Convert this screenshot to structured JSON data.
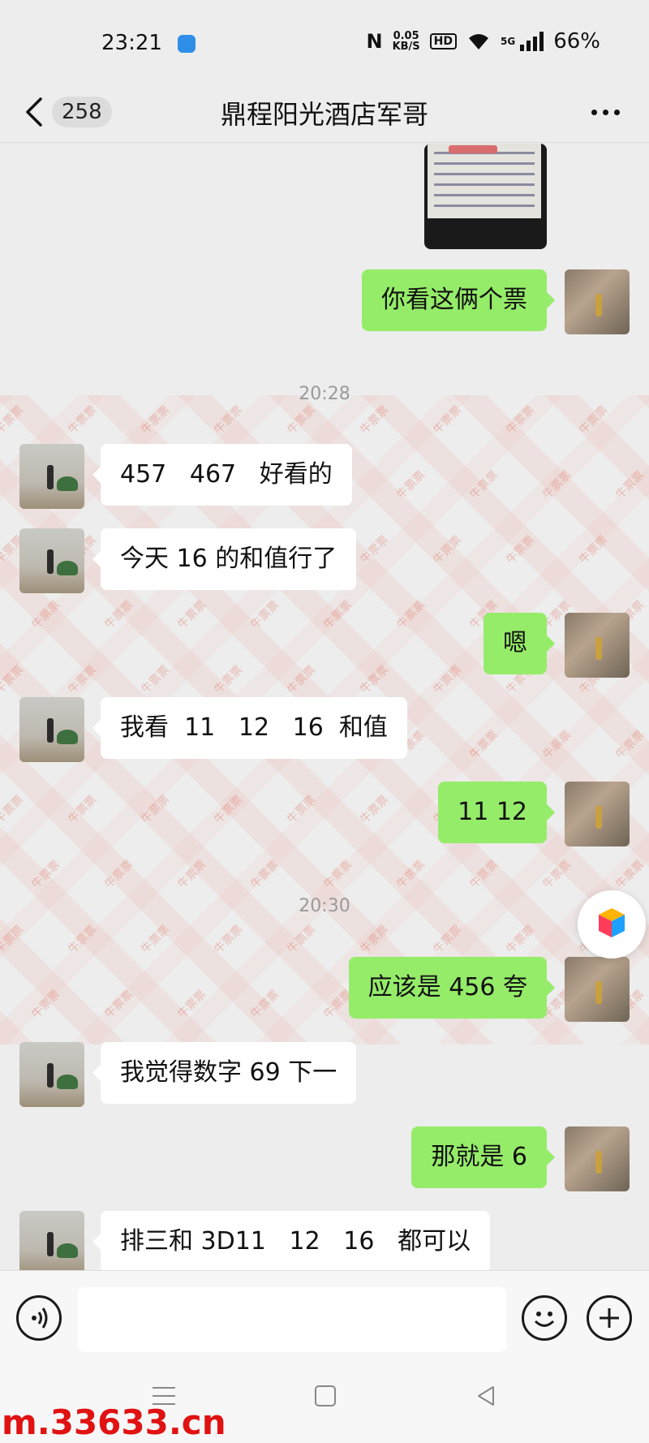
{
  "status_bar": {
    "time": "23:21",
    "net_speed_value": "0.05",
    "net_speed_unit": "KB/S",
    "hd": "HD",
    "network": "5G",
    "battery": "66%"
  },
  "header": {
    "unread_count": "258",
    "title": "鼎程阳光酒店军哥"
  },
  "messages": [
    {
      "side": "self",
      "type": "text",
      "text": "你看这俩个票"
    },
    {
      "type": "time",
      "text": "20:28"
    },
    {
      "side": "other",
      "type": "text",
      "text": "457   467   好看的"
    },
    {
      "side": "other",
      "type": "text",
      "text": "今天 16 的和值行了"
    },
    {
      "side": "self",
      "type": "text",
      "text": "嗯"
    },
    {
      "side": "other",
      "type": "text",
      "text": "我看  11   12   16  和值"
    },
    {
      "side": "self",
      "type": "text",
      "text": "11 12"
    },
    {
      "type": "time",
      "text": "20:30"
    },
    {
      "side": "self",
      "type": "text",
      "text": "应该是 456 夸"
    },
    {
      "side": "other",
      "type": "text",
      "text": "我觉得数字 69 下一"
    },
    {
      "side": "self",
      "type": "text",
      "text": "那就是 6"
    },
    {
      "side": "other",
      "type": "text",
      "text": "排三和 3D11   12   16   都可以"
    }
  ],
  "watermark_text": "牛票票",
  "input": {
    "placeholder": ""
  },
  "site_watermark": "m.33633.cn",
  "colors": {
    "self_bubble": "#95ec69",
    "other_bubble": "#ffffff",
    "background": "#ededed",
    "site_watermark": "#e01212"
  }
}
